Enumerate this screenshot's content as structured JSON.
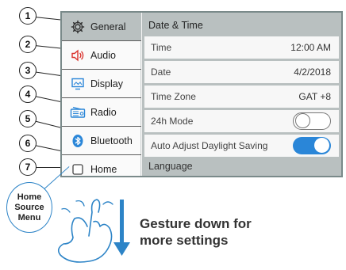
{
  "sidebar": {
    "items": [
      {
        "label": "General",
        "icon": "gear-icon",
        "number": "1"
      },
      {
        "label": "Audio",
        "icon": "speaker-icon",
        "number": "2"
      },
      {
        "label": "Display",
        "icon": "display-icon",
        "number": "3"
      },
      {
        "label": "Radio",
        "icon": "radio-icon",
        "number": "4"
      },
      {
        "label": "Bluetooth",
        "icon": "bluetooth-icon",
        "number": "5"
      },
      {
        "label": "Home",
        "icon": "checkbox-icon",
        "number": "7"
      }
    ],
    "unlabeled_number": "6"
  },
  "content": {
    "title": "Date & Time",
    "rows": [
      {
        "label": "Time",
        "value": "12:00 AM"
      },
      {
        "label": "Date",
        "value": "4/2/2018"
      },
      {
        "label": "Time Zone",
        "value": "GAT +8"
      },
      {
        "label": "24h Mode",
        "toggle": "off"
      },
      {
        "label": "Auto Adjust Daylight Saving",
        "toggle": "on"
      }
    ],
    "next_section": "Language"
  },
  "annotation": {
    "home_label_lines": [
      "Home",
      "Source",
      "Menu"
    ],
    "gesture_lines": [
      "Gesture down for",
      "more settings"
    ]
  },
  "colors": {
    "accent": "#2a86d8",
    "selected_bg": "#b9c0c0",
    "callout_border": "#2d84c7"
  }
}
